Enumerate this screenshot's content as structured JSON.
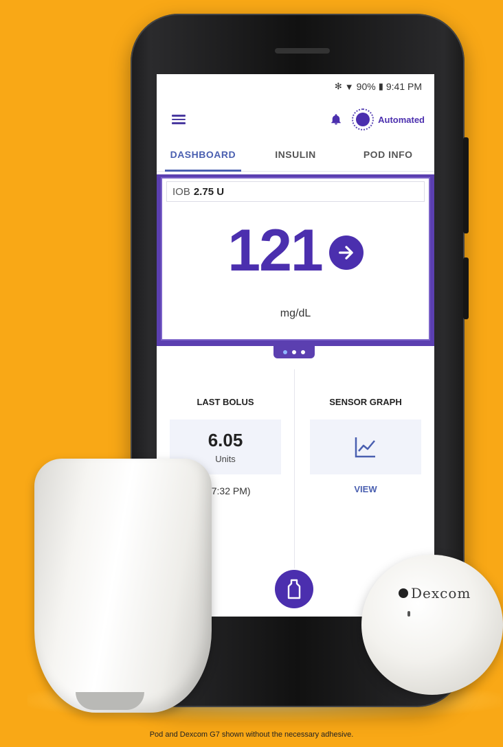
{
  "status_bar": {
    "bluetooth_icon": "bluetooth-icon",
    "wifi_icon": "wifi-icon",
    "battery": "90%",
    "time": "9:41 PM"
  },
  "header": {
    "mode_label": "Automated",
    "menu_icon": "hamburger-icon",
    "bell_icon": "bell-icon"
  },
  "tabs": [
    {
      "label": "DASHBOARD",
      "active": true
    },
    {
      "label": "INSULIN",
      "active": false
    },
    {
      "label": "POD INFO",
      "active": false
    }
  ],
  "glucose": {
    "iob_label": "IOB",
    "iob_value": "2.75 U",
    "value": "121",
    "unit": "mg/dL",
    "trend_icon": "arrow-right-icon"
  },
  "pager": {
    "pages": 3,
    "current": 1
  },
  "last_bolus": {
    "title": "LAST BOLUS",
    "value": "6.05",
    "unit": "Units",
    "time": "0 (7:32 PM)"
  },
  "sensor_graph": {
    "title": "SENSOR GRAPH",
    "icon": "line-chart-icon",
    "link": "VIEW"
  },
  "fab_icon": "bolus-icon",
  "sensor_brand": "Dexcom",
  "caption": "Pod and Dexcom G7 shown without the necessary adhesive.",
  "colors": {
    "background": "#f9a816",
    "accent_purple": "#4b2fae",
    "tab_blue": "#4a5fb0"
  }
}
